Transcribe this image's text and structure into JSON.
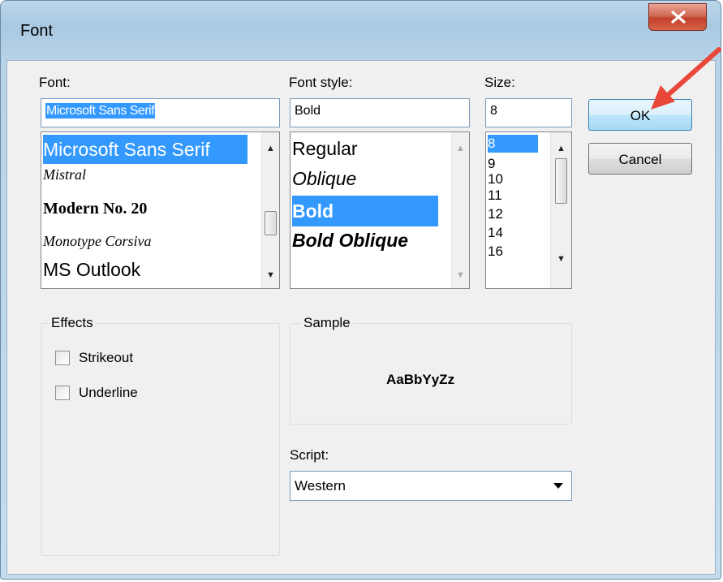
{
  "dialog": {
    "title": "Font"
  },
  "font": {
    "label": "Font:",
    "value": "Microsoft Sans Serif",
    "items": [
      "Microsoft Sans Serif",
      "Mistral",
      "Modern No. 20",
      "Monotype Corsiva",
      "MS Outlook"
    ]
  },
  "style": {
    "label": "Font style:",
    "value": "Bold",
    "items": [
      "Regular",
      "Oblique",
      "Bold",
      "Bold Oblique"
    ]
  },
  "size": {
    "label": "Size:",
    "value": "8",
    "items": [
      "8",
      "9",
      "10",
      "11",
      "12",
      "14",
      "16"
    ]
  },
  "buttons": {
    "ok": "OK",
    "cancel": "Cancel"
  },
  "effects": {
    "legend": "Effects",
    "strikeout": "Strikeout",
    "underline": "Underline"
  },
  "sample": {
    "legend": "Sample",
    "text": "AaBbYyZz"
  },
  "script": {
    "label": "Script:",
    "value": "Western"
  },
  "colors": {
    "selection": "#3399ff",
    "arrow": "#e8473a"
  }
}
